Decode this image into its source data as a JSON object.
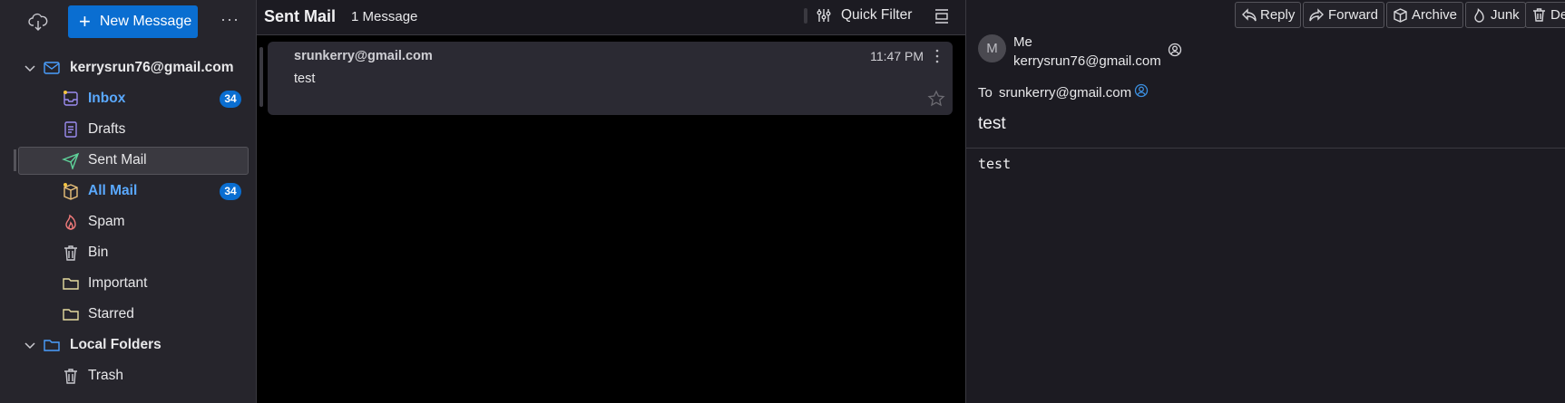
{
  "sidebar": {
    "new_message_label": "New Message",
    "more_label": "···",
    "account": {
      "label": "kerrysrun76@gmail.com"
    },
    "folders": [
      {
        "label": "Inbox",
        "badge": "34",
        "icon": "inbox-icon"
      },
      {
        "label": "Drafts",
        "icon": "drafts-icon"
      },
      {
        "label": "Sent Mail",
        "icon": "sent-icon"
      },
      {
        "label": "All Mail",
        "badge": "34",
        "icon": "archive-box-icon"
      },
      {
        "label": "Spam",
        "icon": "spam-flame-icon"
      },
      {
        "label": "Bin",
        "icon": "trash-icon"
      },
      {
        "label": "Important",
        "icon": "folder-icon"
      },
      {
        "label": "Starred",
        "icon": "folder-icon"
      }
    ],
    "local": {
      "label": "Local Folders"
    },
    "local_folders": [
      {
        "label": "Trash",
        "icon": "trash-icon"
      }
    ]
  },
  "list": {
    "title": "Sent Mail",
    "count": "1 Message",
    "quick_filter": "Quick Filter",
    "messages": [
      {
        "from": "srunkerry@gmail.com",
        "subject": "test",
        "time": "11:47 PM"
      }
    ]
  },
  "reader": {
    "toolbar": {
      "reply": "Reply",
      "forward": "Forward",
      "archive": "Archive",
      "junk": "Junk",
      "delete": "De"
    },
    "avatar_initial": "M",
    "from_name": "Me",
    "from_email": "kerrysrun76@gmail.com",
    "to_label": "To",
    "to_addr": "srunkerry@gmail.com",
    "subject": "test",
    "body": "test"
  },
  "colors": {
    "accent": "#0a6ed1",
    "unread": "#5aa9ff",
    "background": "#1c1b22",
    "sidebar": "#26252c"
  }
}
